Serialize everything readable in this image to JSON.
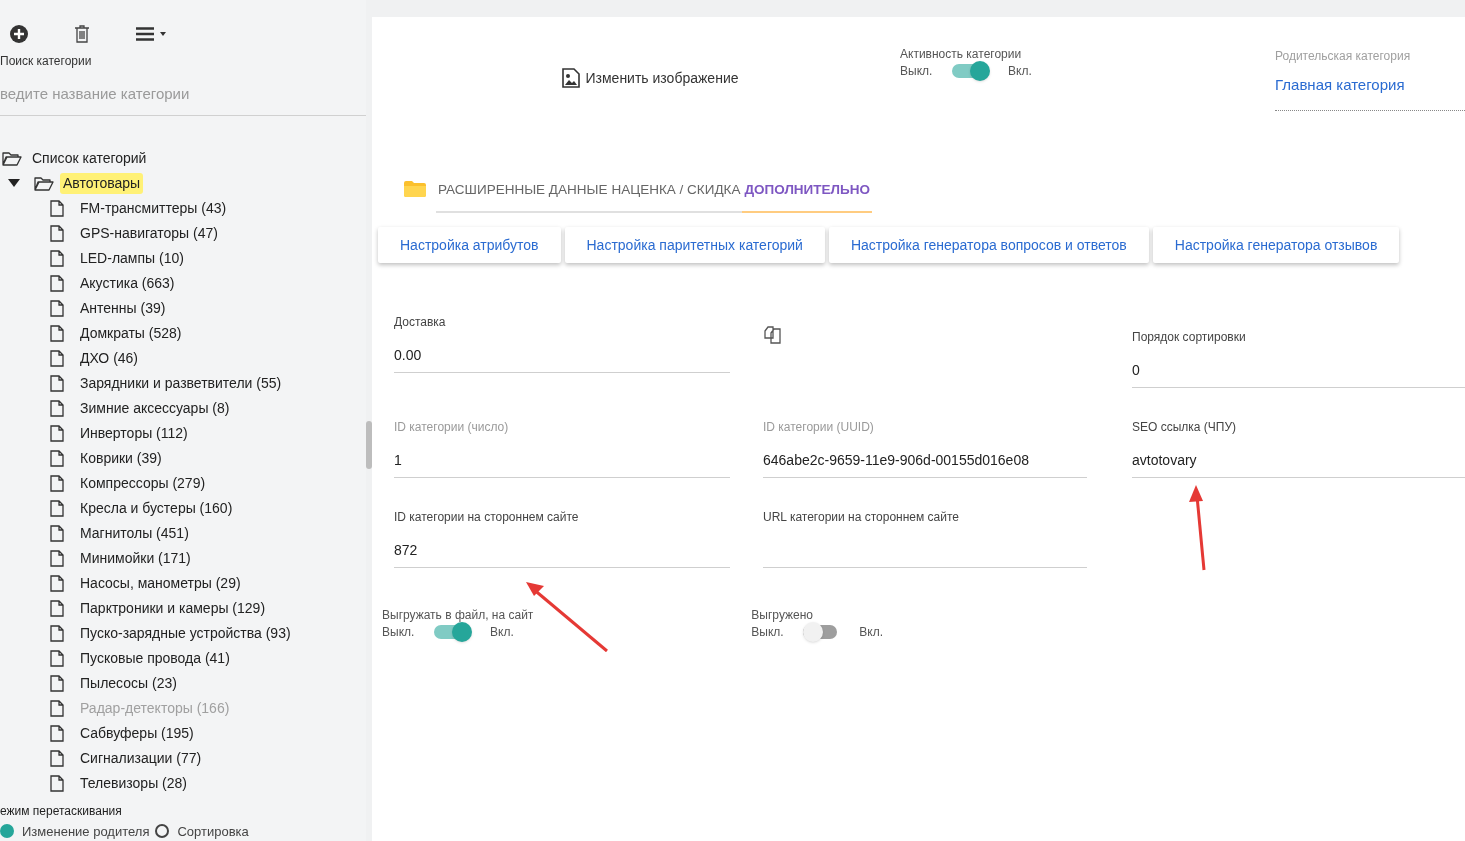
{
  "sidebar": {
    "search": {
      "label": "Поиск категории",
      "placeholder": "ведите название категории"
    },
    "tree": {
      "label": "Список категорий",
      "children": [
        {
          "label": "Автотовары",
          "expanded": true,
          "selected": true,
          "children": [
            {
              "label": "FM-трансмиттеры (43)",
              "disabled": false
            },
            {
              "label": "GPS-навигаторы (47)",
              "disabled": false
            },
            {
              "label": "LED-лампы (10)",
              "disabled": false
            },
            {
              "label": "Акустика (663)",
              "disabled": false
            },
            {
              "label": "Антенны (39)",
              "disabled": false
            },
            {
              "label": "Домкраты (528)",
              "disabled": false
            },
            {
              "label": "ДХО (46)",
              "disabled": false
            },
            {
              "label": "Зарядники и разветвители (55)",
              "disabled": false
            },
            {
              "label": "Зимние аксессуары (8)",
              "disabled": false
            },
            {
              "label": "Инверторы (112)",
              "disabled": false
            },
            {
              "label": "Коврики (39)",
              "disabled": false
            },
            {
              "label": "Компрессоры (279)",
              "disabled": false
            },
            {
              "label": "Кресла и бустеры (160)",
              "disabled": false
            },
            {
              "label": "Магнитолы (451)",
              "disabled": false
            },
            {
              "label": "Минимойки (171)",
              "disabled": false
            },
            {
              "label": "Насосы, манометры (29)",
              "disabled": false
            },
            {
              "label": "Парктроники и камеры (129)",
              "disabled": false
            },
            {
              "label": "Пуско-зарядные устройства (93)",
              "disabled": false
            },
            {
              "label": "Пусковые провода (41)",
              "disabled": false
            },
            {
              "label": "Пылесосы (23)",
              "disabled": false
            },
            {
              "label": "Радар-детекторы (166)",
              "disabled": true
            },
            {
              "label": "Сабвуферы (195)",
              "disabled": false
            },
            {
              "label": "Сигнализации (77)",
              "disabled": false
            },
            {
              "label": "Телевизоры (28)",
              "disabled": false
            }
          ]
        }
      ]
    },
    "drag_mode": {
      "label": "ежим перетаскивания",
      "options": [
        {
          "label": "Изменение родителя",
          "selected": true
        },
        {
          "label": "Сортировка",
          "selected": false
        }
      ]
    }
  },
  "header": {
    "image_button": "Изменить изображение",
    "activity": {
      "label": "Активность категории",
      "off": "Выкл.",
      "on_label": "Вкл.",
      "on": true
    },
    "parent": {
      "label": "Родительская категория",
      "value": "Главная категория"
    }
  },
  "tabs": [
    {
      "label": "РАСШИРЕННЫЕ ДАННЫЕ",
      "selected": false
    },
    {
      "label": "НАЦЕНКА / СКИДКА",
      "selected": false
    },
    {
      "label": "ДОПОЛНИТЕЛЬНО",
      "selected": true
    }
  ],
  "buttons": [
    "Настройка атрибутов",
    "Настройка паритетных категорий",
    "Настройка генератора вопросов и ответов",
    "Настройка генератора отзывов"
  ],
  "fields": [
    {
      "kind": "input",
      "label": "Доставка",
      "value": "0.00",
      "disabled": false
    },
    {
      "kind": "copy"
    },
    {
      "kind": "input",
      "label": "Порядок сортировки",
      "value": "0",
      "disabled": false
    },
    {
      "kind": "input",
      "label": "ID категории (число)",
      "value": "1",
      "disabled": true
    },
    {
      "kind": "input",
      "label": "ID категории (UUID)",
      "value": "646abe2c-9659-11e9-906d-00155d016e08",
      "disabled": true
    },
    {
      "kind": "input",
      "label": "SEO ссылка (ЧПУ)",
      "value": "avtotovary",
      "disabled": false
    },
    {
      "kind": "input",
      "label": "ID категории на стороннем сайте",
      "value": "872",
      "disabled": false
    },
    {
      "kind": "input",
      "label": "URL категории на стороннем сайте",
      "disabled": false
    }
  ],
  "toggles": [
    {
      "label": "Выгружать в файл, на сайт",
      "off": "Выкл.",
      "on_label": "Вкл.",
      "on": true
    },
    {
      "label": "Выгружено",
      "off": "Выкл.",
      "on_label": "Вкл.",
      "on": false
    }
  ]
}
